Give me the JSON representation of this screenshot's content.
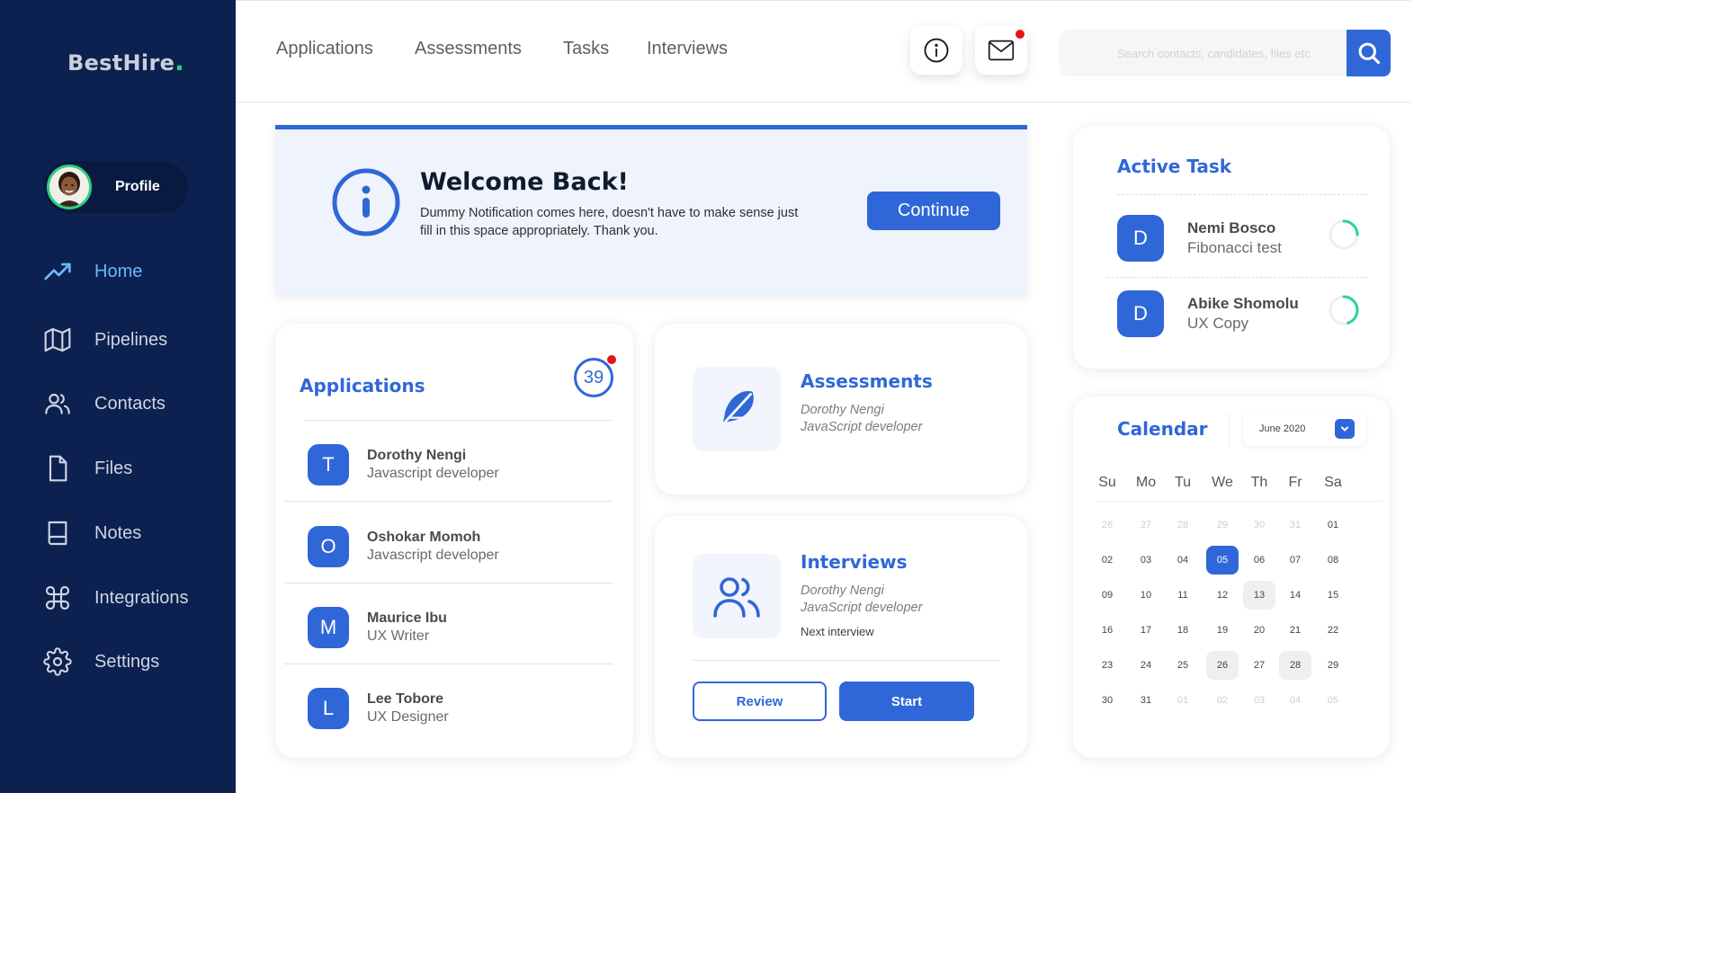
{
  "brand": {
    "name": "BestHire",
    "dot": ".",
    "accent": "#2bd17e"
  },
  "profile": {
    "label": "Profile"
  },
  "sidebar": {
    "items": [
      {
        "label": "Home",
        "icon": "trending-up-icon",
        "active": true
      },
      {
        "label": "Pipelines",
        "icon": "map-icon"
      },
      {
        "label": "Contacts",
        "icon": "users-icon"
      },
      {
        "label": "Files",
        "icon": "file-icon"
      },
      {
        "label": "Notes",
        "icon": "book-icon"
      },
      {
        "label": "Integrations",
        "icon": "command-icon"
      },
      {
        "label": "Settings",
        "icon": "gear-icon"
      }
    ]
  },
  "header": {
    "tabs": [
      "Applications",
      "Assessments",
      "Tasks",
      "Interviews"
    ],
    "search_placeholder": "Search contacts, candidates, files etc."
  },
  "welcome": {
    "title": "Welcome Back!",
    "text": "Dummy Notification comes here, doesn't have to make sense just fill in this space appropriately. Thank you.",
    "button": "Continue"
  },
  "applications": {
    "title": "Applications",
    "count": "39",
    "rows": [
      {
        "letter": "T",
        "name": "Dorothy Nengi",
        "role": "Javascript developer"
      },
      {
        "letter": "O",
        "name": "Oshokar Momoh",
        "role": "Javascript developer"
      },
      {
        "letter": "M",
        "name": "Maurice Ibu",
        "role": "UX Writer"
      },
      {
        "letter": "L",
        "name": "Lee Tobore",
        "role": "UX Designer"
      }
    ]
  },
  "assessments": {
    "title": "Assessments",
    "name": "Dorothy Nengi",
    "role": "JavaScript developer"
  },
  "interviews": {
    "title": "Interviews",
    "name": "Dorothy Nengi",
    "role": "JavaScript developer",
    "next": "Next interview",
    "review": "Review",
    "start": "Start"
  },
  "active_task": {
    "title": "Active Task",
    "tasks": [
      {
        "letter": "D",
        "name": "Nemi Bosco",
        "task": "Fibonacci test",
        "progress": 0.25
      },
      {
        "letter": "D",
        "name": "Abike Shomolu",
        "task": "UX Copy",
        "progress": 0.45
      }
    ]
  },
  "calendar": {
    "title": "Calendar",
    "month": "June 2020",
    "weekdays": [
      "Su",
      "Mo",
      "Tu",
      "We",
      "Th",
      "Fr",
      "Sa"
    ],
    "weeks": [
      [
        "26",
        "27",
        "28",
        "29",
        "30",
        "31",
        "01"
      ],
      [
        "02",
        "03",
        "04",
        "05",
        "06",
        "07",
        "08"
      ],
      [
        "09",
        "10",
        "11",
        "12",
        "13",
        "14",
        "15"
      ],
      [
        "16",
        "17",
        "18",
        "19",
        "20",
        "21",
        "22"
      ],
      [
        "23",
        "24",
        "25",
        "26",
        "27",
        "28",
        "29"
      ],
      [
        "30",
        "31",
        "01",
        "02",
        "03",
        "04",
        "05"
      ]
    ],
    "selected": "05",
    "marked": [
      "13",
      "26",
      "28"
    ]
  },
  "colors": {
    "primary": "#2f67d8",
    "sidebar": "#0c214f",
    "ring": "#2bd1a0",
    "notify": "#e8131a"
  }
}
